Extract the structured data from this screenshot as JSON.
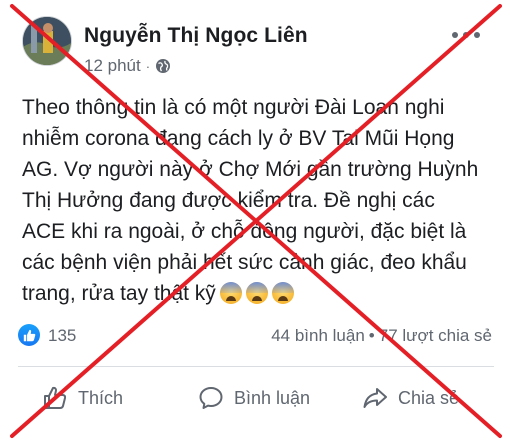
{
  "post": {
    "author": "Nguyễn Thị Ngọc Liên",
    "time": "12 phút",
    "separator": "·",
    "privacy_icon": "globe-icon",
    "body_lines": [
      "Theo thông tin là có một người Đài Loan nghi",
      "nhiễm corona đang cách ly ở BV Tai Mũi Họng",
      "AG. Vợ người này  ở Chợ Mới gần trường Huỳnh",
      "Thị Hưởng đang được kiểm tra. Đề nghị các",
      "ACE khi ra ngoài, ở chỗ đông người, đặc biệt là",
      "các bệnh viện phải hết sức cảnh giác, đeo khẩu",
      "trang, rửa tay thật kỹ"
    ],
    "emojis": [
      "fearful-face-emoji",
      "fearful-face-emoji",
      "fearful-face-emoji"
    ]
  },
  "stats": {
    "like_count": "135",
    "comments": "44 bình luận",
    "dot": "•",
    "shares": "77 lượt chia sẻ"
  },
  "actions": {
    "like_label": "Thích",
    "comment_label": "Bình luận",
    "share_label": "Chia sẻ"
  },
  "colors": {
    "text": "#1c1e21",
    "muted": "#606770",
    "facebook_blue": "#1877f2",
    "cross": "#e41f26"
  }
}
